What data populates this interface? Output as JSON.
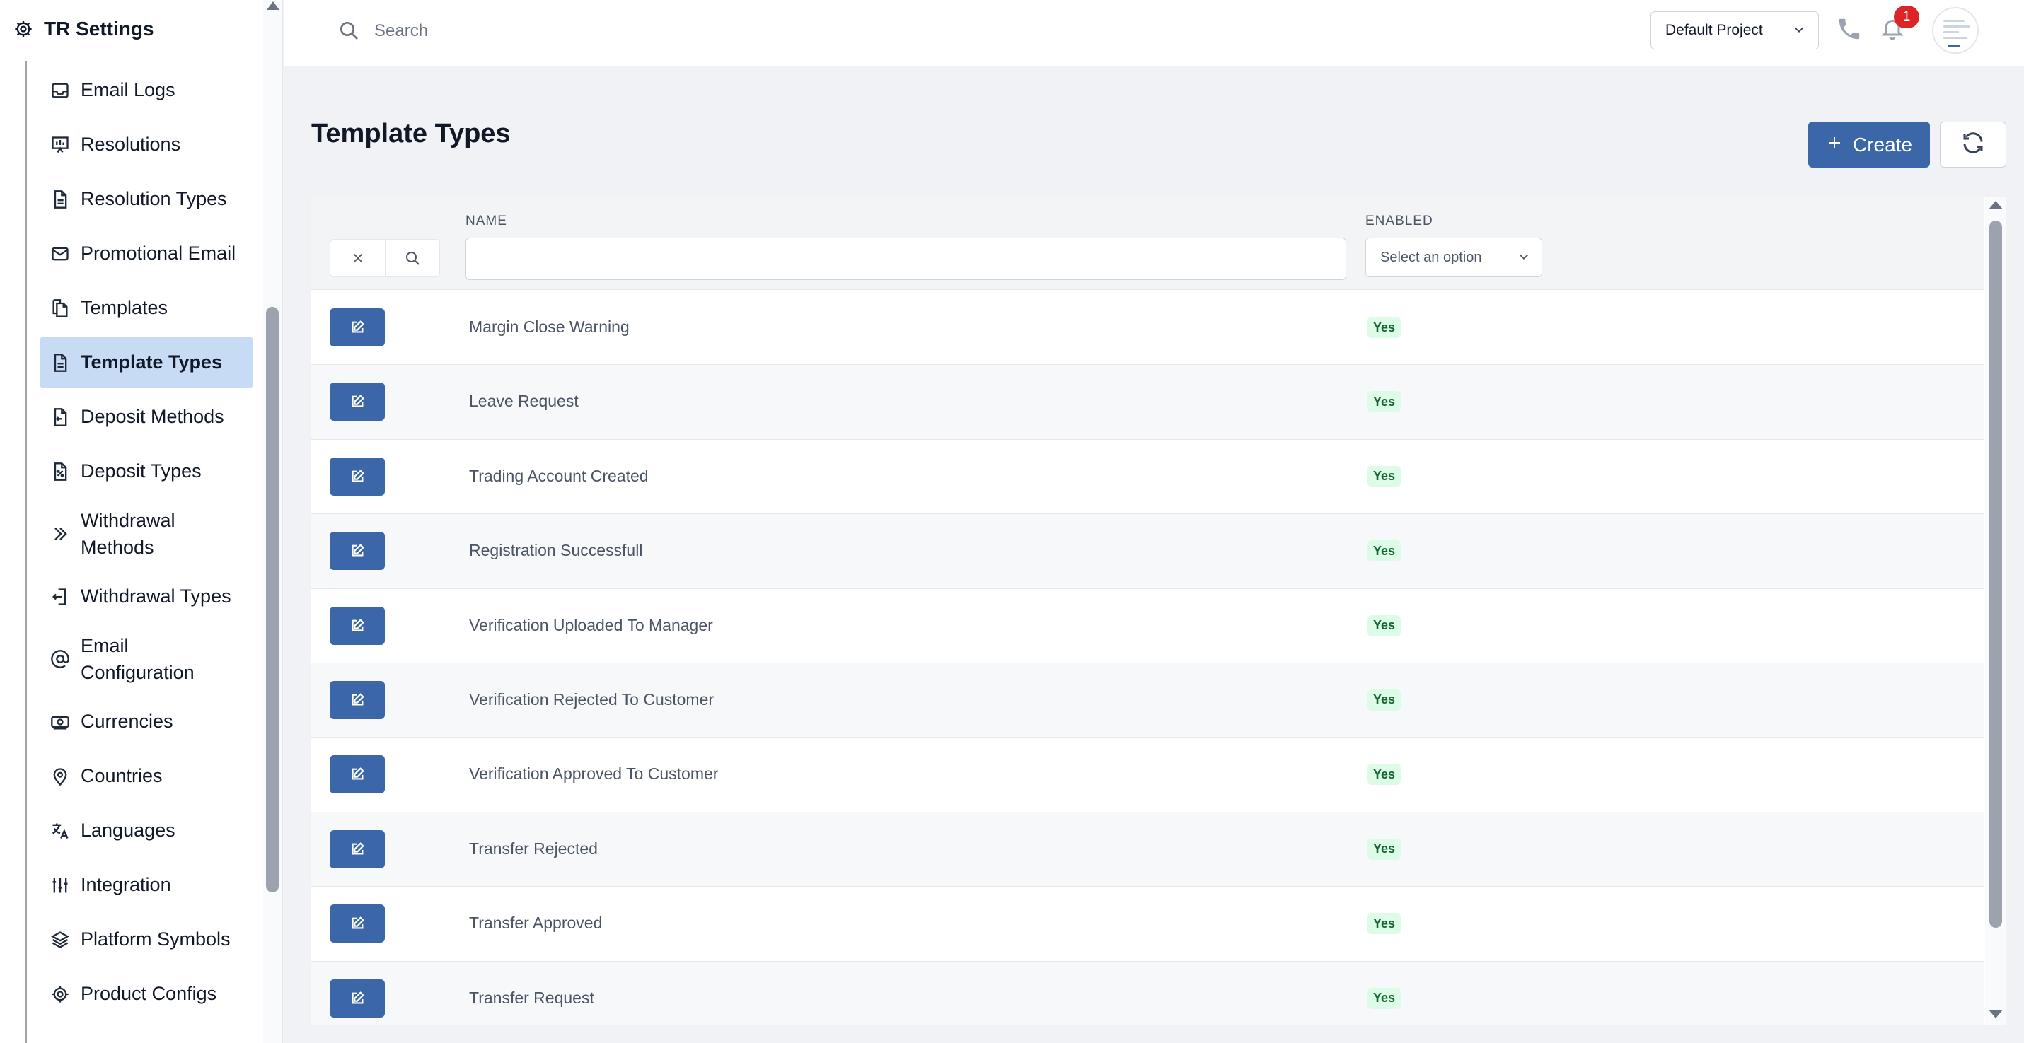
{
  "sidebar": {
    "title": "TR Settings",
    "items": [
      {
        "label": "Email Logs",
        "icon": "inbox-icon"
      },
      {
        "label": "Resolutions",
        "icon": "presentation-icon"
      },
      {
        "label": "Resolution Types",
        "icon": "document-icon"
      },
      {
        "label": "Promotional Email",
        "icon": "envelope-icon"
      },
      {
        "label": "Templates",
        "icon": "copy-icon"
      },
      {
        "label": "Template Types",
        "icon": "document-icon",
        "active": true
      },
      {
        "label": "Deposit Methods",
        "icon": "receipt-icon"
      },
      {
        "label": "Deposit Types",
        "icon": "receipt-percent-icon"
      },
      {
        "label": "Withdrawal Methods",
        "icon": "chevrons-right-icon"
      },
      {
        "label": "Withdrawal Types",
        "icon": "logout-icon"
      },
      {
        "label": "Email Configuration",
        "icon": "at-sign-icon"
      },
      {
        "label": "Currencies",
        "icon": "banknote-icon"
      },
      {
        "label": "Countries",
        "icon": "map-pin-icon"
      },
      {
        "label": "Languages",
        "icon": "translate-icon"
      },
      {
        "label": "Integration",
        "icon": "sliders-icon"
      },
      {
        "label": "Platform Symbols",
        "icon": "layers-icon"
      },
      {
        "label": "Product Configs",
        "icon": "gear-icon"
      }
    ]
  },
  "topbar": {
    "search_placeholder": "Search",
    "project": "Default Project",
    "notification_count": "1"
  },
  "page": {
    "title": "Template Types",
    "create_label": "Create"
  },
  "table": {
    "columns": {
      "name": "NAME",
      "enabled": "ENABLED"
    },
    "enabled_placeholder": "Select an option",
    "rows": [
      {
        "name": "Margin Close Warning",
        "enabled": "Yes"
      },
      {
        "name": "Leave Request",
        "enabled": "Yes"
      },
      {
        "name": "Trading Account Created",
        "enabled": "Yes"
      },
      {
        "name": "Registration Successfull",
        "enabled": "Yes"
      },
      {
        "name": "Verification Uploaded To Manager",
        "enabled": "Yes"
      },
      {
        "name": "Verification Rejected To Customer",
        "enabled": "Yes"
      },
      {
        "name": "Verification Approved To Customer",
        "enabled": "Yes"
      },
      {
        "name": "Transfer Rejected",
        "enabled": "Yes"
      },
      {
        "name": "Transfer Approved",
        "enabled": "Yes"
      },
      {
        "name": "Transfer Request",
        "enabled": "Yes"
      }
    ]
  },
  "colors": {
    "primary": "#3b66a8",
    "active_bg": "#c7dbf5",
    "badge_bg": "#dcfce7",
    "badge_text": "#166534",
    "notification": "#dc2626"
  }
}
